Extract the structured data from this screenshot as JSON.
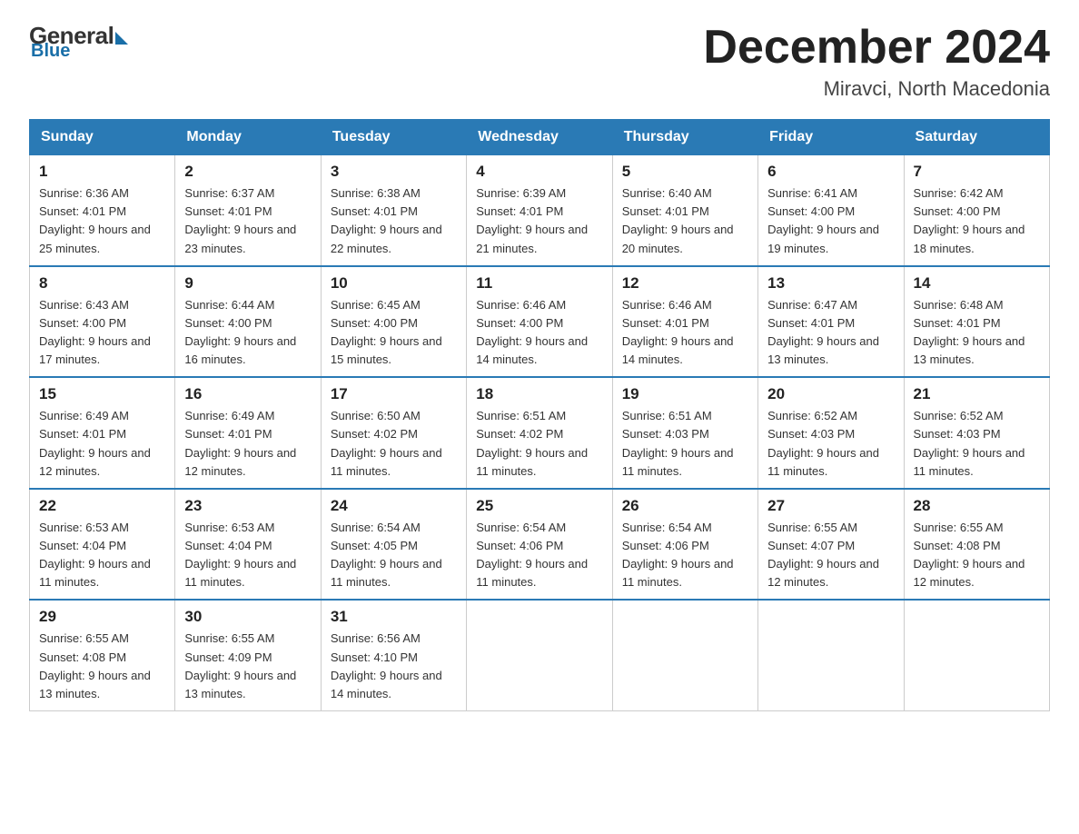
{
  "header": {
    "logo": {
      "general": "General",
      "blue": "Blue"
    },
    "title": "December 2024",
    "location": "Miravci, North Macedonia"
  },
  "days_of_week": [
    "Sunday",
    "Monday",
    "Tuesday",
    "Wednesday",
    "Thursday",
    "Friday",
    "Saturday"
  ],
  "weeks": [
    [
      {
        "num": "1",
        "sunrise": "6:36 AM",
        "sunset": "4:01 PM",
        "daylight": "9 hours and 25 minutes."
      },
      {
        "num": "2",
        "sunrise": "6:37 AM",
        "sunset": "4:01 PM",
        "daylight": "9 hours and 23 minutes."
      },
      {
        "num": "3",
        "sunrise": "6:38 AM",
        "sunset": "4:01 PM",
        "daylight": "9 hours and 22 minutes."
      },
      {
        "num": "4",
        "sunrise": "6:39 AM",
        "sunset": "4:01 PM",
        "daylight": "9 hours and 21 minutes."
      },
      {
        "num": "5",
        "sunrise": "6:40 AM",
        "sunset": "4:01 PM",
        "daylight": "9 hours and 20 minutes."
      },
      {
        "num": "6",
        "sunrise": "6:41 AM",
        "sunset": "4:00 PM",
        "daylight": "9 hours and 19 minutes."
      },
      {
        "num": "7",
        "sunrise": "6:42 AM",
        "sunset": "4:00 PM",
        "daylight": "9 hours and 18 minutes."
      }
    ],
    [
      {
        "num": "8",
        "sunrise": "6:43 AM",
        "sunset": "4:00 PM",
        "daylight": "9 hours and 17 minutes."
      },
      {
        "num": "9",
        "sunrise": "6:44 AM",
        "sunset": "4:00 PM",
        "daylight": "9 hours and 16 minutes."
      },
      {
        "num": "10",
        "sunrise": "6:45 AM",
        "sunset": "4:00 PM",
        "daylight": "9 hours and 15 minutes."
      },
      {
        "num": "11",
        "sunrise": "6:46 AM",
        "sunset": "4:00 PM",
        "daylight": "9 hours and 14 minutes."
      },
      {
        "num": "12",
        "sunrise": "6:46 AM",
        "sunset": "4:01 PM",
        "daylight": "9 hours and 14 minutes."
      },
      {
        "num": "13",
        "sunrise": "6:47 AM",
        "sunset": "4:01 PM",
        "daylight": "9 hours and 13 minutes."
      },
      {
        "num": "14",
        "sunrise": "6:48 AM",
        "sunset": "4:01 PM",
        "daylight": "9 hours and 13 minutes."
      }
    ],
    [
      {
        "num": "15",
        "sunrise": "6:49 AM",
        "sunset": "4:01 PM",
        "daylight": "9 hours and 12 minutes."
      },
      {
        "num": "16",
        "sunrise": "6:49 AM",
        "sunset": "4:01 PM",
        "daylight": "9 hours and 12 minutes."
      },
      {
        "num": "17",
        "sunrise": "6:50 AM",
        "sunset": "4:02 PM",
        "daylight": "9 hours and 11 minutes."
      },
      {
        "num": "18",
        "sunrise": "6:51 AM",
        "sunset": "4:02 PM",
        "daylight": "9 hours and 11 minutes."
      },
      {
        "num": "19",
        "sunrise": "6:51 AM",
        "sunset": "4:03 PM",
        "daylight": "9 hours and 11 minutes."
      },
      {
        "num": "20",
        "sunrise": "6:52 AM",
        "sunset": "4:03 PM",
        "daylight": "9 hours and 11 minutes."
      },
      {
        "num": "21",
        "sunrise": "6:52 AM",
        "sunset": "4:03 PM",
        "daylight": "9 hours and 11 minutes."
      }
    ],
    [
      {
        "num": "22",
        "sunrise": "6:53 AM",
        "sunset": "4:04 PM",
        "daylight": "9 hours and 11 minutes."
      },
      {
        "num": "23",
        "sunrise": "6:53 AM",
        "sunset": "4:04 PM",
        "daylight": "9 hours and 11 minutes."
      },
      {
        "num": "24",
        "sunrise": "6:54 AM",
        "sunset": "4:05 PM",
        "daylight": "9 hours and 11 minutes."
      },
      {
        "num": "25",
        "sunrise": "6:54 AM",
        "sunset": "4:06 PM",
        "daylight": "9 hours and 11 minutes."
      },
      {
        "num": "26",
        "sunrise": "6:54 AM",
        "sunset": "4:06 PM",
        "daylight": "9 hours and 11 minutes."
      },
      {
        "num": "27",
        "sunrise": "6:55 AM",
        "sunset": "4:07 PM",
        "daylight": "9 hours and 12 minutes."
      },
      {
        "num": "28",
        "sunrise": "6:55 AM",
        "sunset": "4:08 PM",
        "daylight": "9 hours and 12 minutes."
      }
    ],
    [
      {
        "num": "29",
        "sunrise": "6:55 AM",
        "sunset": "4:08 PM",
        "daylight": "9 hours and 13 minutes."
      },
      {
        "num": "30",
        "sunrise": "6:55 AM",
        "sunset": "4:09 PM",
        "daylight": "9 hours and 13 minutes."
      },
      {
        "num": "31",
        "sunrise": "6:56 AM",
        "sunset": "4:10 PM",
        "daylight": "9 hours and 14 minutes."
      },
      null,
      null,
      null,
      null
    ]
  ]
}
